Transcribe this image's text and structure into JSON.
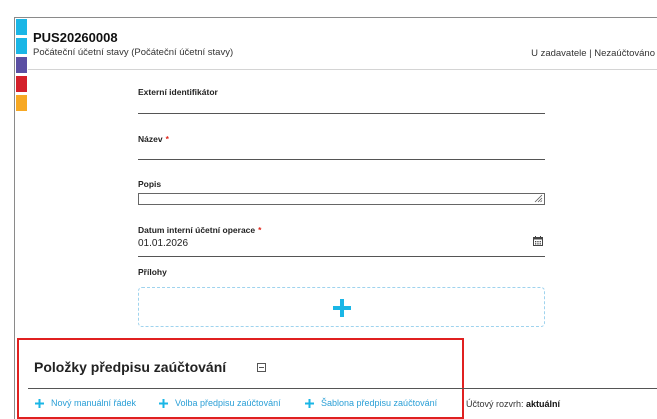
{
  "colors": {
    "stripes": [
      "#1ab6e6",
      "#1ab6e6",
      "#5b4fa3",
      "#d4202a",
      "#f7a823"
    ],
    "accent": "#1ab6e6",
    "highlight_border": "#e02020"
  },
  "header": {
    "doc_id": "PUS20260008",
    "subtitle": "Počáteční účetní stavy (Počáteční účetní stavy)",
    "status": "U zadavatele | Nezaúčtováno"
  },
  "form": {
    "external_id": {
      "label": "Externí identifikátor",
      "value": ""
    },
    "name": {
      "label": "Název",
      "required_mark": "*",
      "value": ""
    },
    "description": {
      "label": "Popis",
      "value": ""
    },
    "date": {
      "label": "Datum interní účetní operace",
      "required_mark": "*",
      "value": "01.01.2026",
      "icon": "calendar-icon"
    },
    "attachments": {
      "label": "Přílohy",
      "icon": "plus-icon"
    }
  },
  "section": {
    "title": "Položky předpisu zaúčtování",
    "collapse_icon": "collapse-icon",
    "actions": [
      {
        "label": "Nový manuální řádek",
        "icon": "plus-icon"
      },
      {
        "label": "Volba předpisu zaúčtování",
        "icon": "plus-icon"
      },
      {
        "label": "Šablona předpisu zaúčtování",
        "icon": "plus-icon"
      }
    ],
    "rozvrh_label": "Účtový rozvrh:",
    "rozvrh_value": "aktuální"
  }
}
